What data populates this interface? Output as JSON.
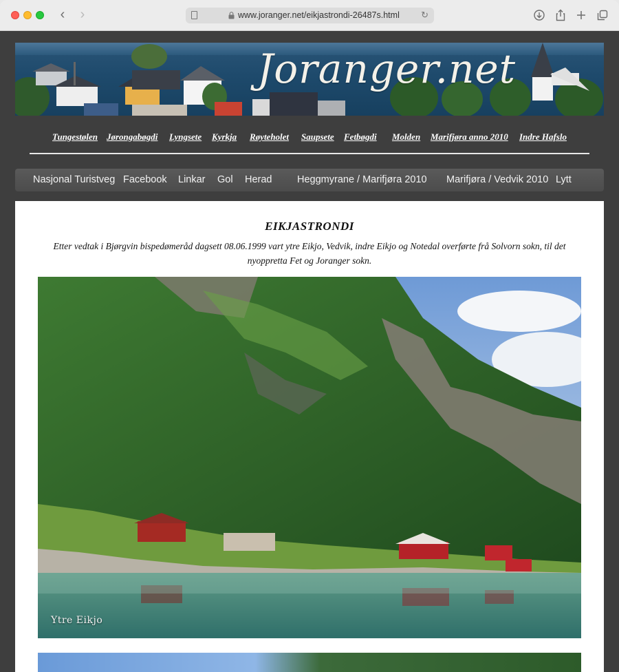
{
  "browser": {
    "url": "www.joranger.net/eikjastrondi-26487s.html"
  },
  "site": {
    "logo_text": "Joranger.net"
  },
  "top_nav": [
    {
      "label": "Tungestølen"
    },
    {
      "label": "Jørongabøgdi"
    },
    {
      "label": "Lyngsete"
    },
    {
      "label": "Kyrkja"
    },
    {
      "label": "Røyteholet"
    },
    {
      "label": "Saupsete"
    },
    {
      "label": "Fetbøgdi"
    },
    {
      "label": "Molden"
    },
    {
      "label": "Marifjøra anno 2010"
    },
    {
      "label": "Indre Hafslo"
    }
  ],
  "menu_bar": [
    {
      "label": "Nasjonal Turistveg"
    },
    {
      "label": "Facebook"
    },
    {
      "label": "Linkar"
    },
    {
      "label": "Gol"
    },
    {
      "label": "Herad"
    },
    {
      "label": "Heggmyrane / Marifjøra 2010"
    },
    {
      "label": "Marifjøra / Vedvik 2010"
    },
    {
      "label": "Lytt"
    }
  ],
  "content": {
    "heading": "EIKJASTRONDI",
    "intro": "Etter vedtak i Bjørgvin bispedømeråd dagsett 08.06.1999 vart ytre Eikjo, Vedvik, indre Eikjo og Notedal overførte frå Solvorn sokn, til det nyoppretta Fet og Joranger sokn.",
    "photo_caption": "Ytre Eikjo"
  }
}
